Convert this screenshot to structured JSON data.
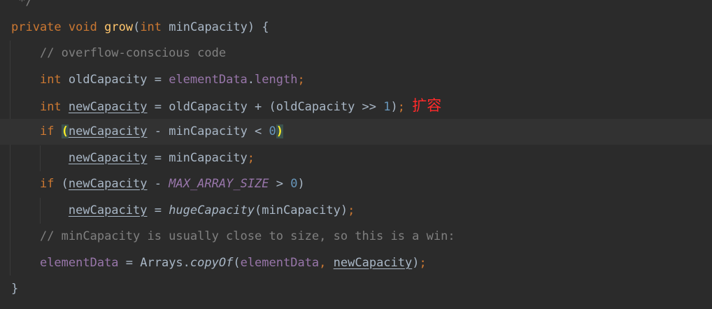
{
  "editor": {
    "lines": [
      {
        "id": "line-0",
        "tokens": [
          {
            "text": " */",
            "kind": "cmt"
          }
        ]
      },
      {
        "id": "line-1",
        "tokens": [
          {
            "text": "private",
            "kind": "kw"
          },
          {
            "text": " ",
            "kind": "plain"
          },
          {
            "text": "void",
            "kind": "kw"
          },
          {
            "text": " ",
            "kind": "plain"
          },
          {
            "text": "grow",
            "kind": "fn"
          },
          {
            "text": "(",
            "kind": "plain"
          },
          {
            "text": "int",
            "kind": "kw"
          },
          {
            "text": " minCapacity) {",
            "kind": "plain"
          }
        ]
      },
      {
        "id": "line-2",
        "tokens": [
          {
            "text": "    ",
            "kind": "plain"
          },
          {
            "text": "// overflow-conscious code",
            "kind": "cmt"
          }
        ]
      },
      {
        "id": "line-3",
        "tokens": [
          {
            "text": "    ",
            "kind": "plain"
          },
          {
            "text": "int",
            "kind": "kw"
          },
          {
            "text": " oldCapacity = ",
            "kind": "plain"
          },
          {
            "text": "elementData",
            "kind": "field"
          },
          {
            "text": ".",
            "kind": "plain"
          },
          {
            "text": "length",
            "kind": "field"
          },
          {
            "text": ";",
            "kind": "kw"
          }
        ]
      },
      {
        "id": "line-4",
        "tokens": [
          {
            "text": "    ",
            "kind": "plain"
          },
          {
            "text": "int",
            "kind": "kw"
          },
          {
            "text": " ",
            "kind": "plain"
          },
          {
            "text": "newCapacity",
            "kind": "reassigned"
          },
          {
            "text": " = oldCapacity + (oldCapacity >> ",
            "kind": "plain"
          },
          {
            "text": "1",
            "kind": "num"
          },
          {
            "text": ")",
            "kind": "plain"
          },
          {
            "text": ";",
            "kind": "kw"
          },
          {
            "text": " ",
            "kind": "plain"
          },
          {
            "text": "扩容",
            "kind": "annotation"
          }
        ]
      },
      {
        "id": "line-5",
        "current": true,
        "tokens": [
          {
            "text": "    ",
            "kind": "plain"
          },
          {
            "text": "if",
            "kind": "kw"
          },
          {
            "text": " ",
            "kind": "plain"
          },
          {
            "text": "(",
            "kind": "brace-match"
          },
          {
            "text": "newCapacity",
            "kind": "reassigned"
          },
          {
            "text": " - minCapacity < ",
            "kind": "plain"
          },
          {
            "text": "0",
            "kind": "num"
          },
          {
            "text": ")",
            "kind": "brace-match"
          }
        ]
      },
      {
        "id": "line-6",
        "tokens": [
          {
            "text": "        ",
            "kind": "plain"
          },
          {
            "text": "newCapacity",
            "kind": "reassigned"
          },
          {
            "text": " = minCapacity",
            "kind": "plain"
          },
          {
            "text": ";",
            "kind": "kw"
          }
        ]
      },
      {
        "id": "line-7",
        "tokens": [
          {
            "text": "    ",
            "kind": "plain"
          },
          {
            "text": "if",
            "kind": "kw"
          },
          {
            "text": " (",
            "kind": "plain"
          },
          {
            "text": "newCapacity",
            "kind": "reassigned"
          },
          {
            "text": " - ",
            "kind": "plain"
          },
          {
            "text": "MAX_ARRAY_SIZE",
            "kind": "const"
          },
          {
            "text": " > ",
            "kind": "plain"
          },
          {
            "text": "0",
            "kind": "num"
          },
          {
            "text": ")",
            "kind": "plain"
          }
        ]
      },
      {
        "id": "line-8",
        "tokens": [
          {
            "text": "        ",
            "kind": "plain"
          },
          {
            "text": "newCapacity",
            "kind": "reassigned"
          },
          {
            "text": " = ",
            "kind": "plain"
          },
          {
            "text": "hugeCapacity",
            "kind": "italic-call"
          },
          {
            "text": "(minCapacity)",
            "kind": "plain"
          },
          {
            "text": ";",
            "kind": "kw"
          }
        ]
      },
      {
        "id": "line-9",
        "tokens": [
          {
            "text": "    ",
            "kind": "plain"
          },
          {
            "text": "// minCapacity is usually close to size, so this is a win:",
            "kind": "cmt"
          }
        ]
      },
      {
        "id": "line-10",
        "tokens": [
          {
            "text": "    ",
            "kind": "plain"
          },
          {
            "text": "elementData",
            "kind": "field"
          },
          {
            "text": " = Arrays.",
            "kind": "plain"
          },
          {
            "text": "copyOf",
            "kind": "italic-call"
          },
          {
            "text": "(",
            "kind": "plain"
          },
          {
            "text": "elementData",
            "kind": "field"
          },
          {
            "text": ", ",
            "kind": "kw"
          },
          {
            "text": "newCapacity",
            "kind": "reassigned"
          },
          {
            "text": ")",
            "kind": "plain"
          },
          {
            "text": ";",
            "kind": "kw"
          }
        ]
      },
      {
        "id": "line-11",
        "tokens": [
          {
            "text": "}",
            "kind": "plain"
          }
        ]
      }
    ]
  }
}
